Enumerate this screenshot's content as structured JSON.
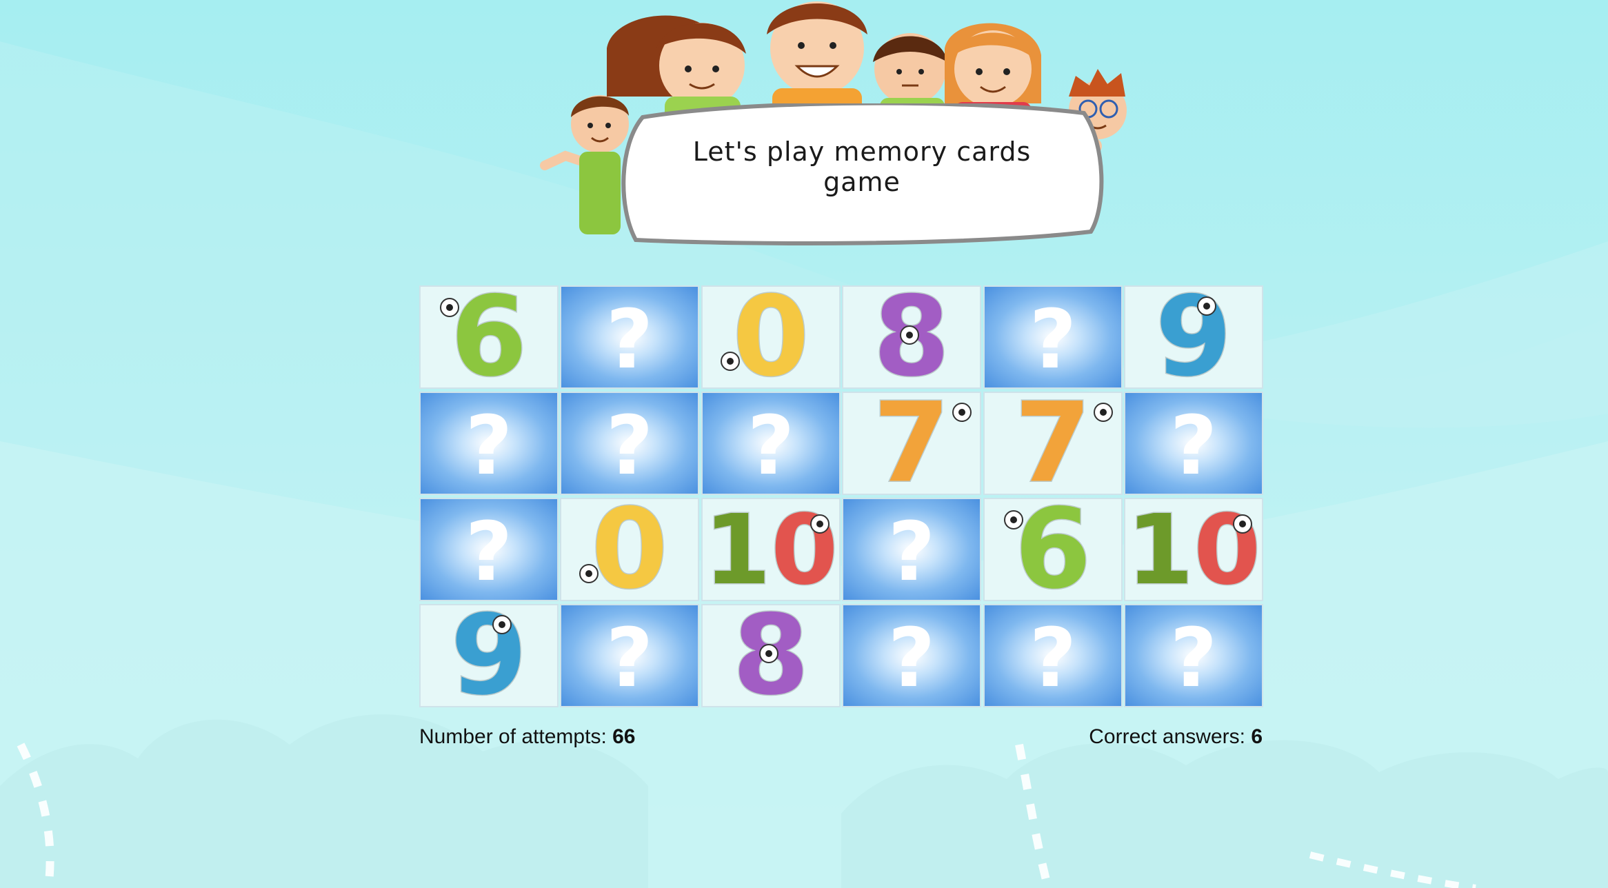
{
  "game": {
    "title": "Let's play memory cards game"
  },
  "cards": [
    {
      "state": "open",
      "value": "6",
      "color": "#8cc63f"
    },
    {
      "state": "hidden",
      "value": "?",
      "color": "#ffffff"
    },
    {
      "state": "open",
      "value": "0",
      "color": "#f5c842"
    },
    {
      "state": "open",
      "value": "8",
      "color": "#a25dc4"
    },
    {
      "state": "hidden",
      "value": "?",
      "color": "#ffffff"
    },
    {
      "state": "open",
      "value": "9",
      "color": "#3a9fd1"
    },
    {
      "state": "hidden",
      "value": "?",
      "color": "#ffffff"
    },
    {
      "state": "hidden",
      "value": "?",
      "color": "#ffffff"
    },
    {
      "state": "hidden",
      "value": "?",
      "color": "#ffffff"
    },
    {
      "state": "open",
      "value": "7",
      "color": "#f2a33a"
    },
    {
      "state": "open",
      "value": "7",
      "color": "#f2a33a"
    },
    {
      "state": "hidden",
      "value": "?",
      "color": "#ffffff"
    },
    {
      "state": "hidden",
      "value": "?",
      "color": "#ffffff"
    },
    {
      "state": "open",
      "value": "0",
      "color": "#f5c842"
    },
    {
      "state": "open",
      "value": "10",
      "color": "#e2544e"
    },
    {
      "state": "hidden",
      "value": "?",
      "color": "#ffffff"
    },
    {
      "state": "open",
      "value": "6",
      "color": "#8cc63f"
    },
    {
      "state": "open",
      "value": "10",
      "color": "#e2544e"
    },
    {
      "state": "open",
      "value": "9",
      "color": "#3a9fd1"
    },
    {
      "state": "hidden",
      "value": "?",
      "color": "#ffffff"
    },
    {
      "state": "open",
      "value": "8",
      "color": "#a25dc4"
    },
    {
      "state": "hidden",
      "value": "?",
      "color": "#ffffff"
    },
    {
      "state": "hidden",
      "value": "?",
      "color": "#ffffff"
    },
    {
      "state": "hidden",
      "value": "?",
      "color": "#ffffff"
    }
  ],
  "stats": {
    "attempts_label": "Number of attempts: ",
    "attempts_value": "66",
    "correct_label": "Correct answers: ",
    "correct_value": "6"
  },
  "colors": {
    "background": "#a6eef1",
    "card_back": "#4b91e0",
    "number_one_green": "#6d9a2a"
  }
}
